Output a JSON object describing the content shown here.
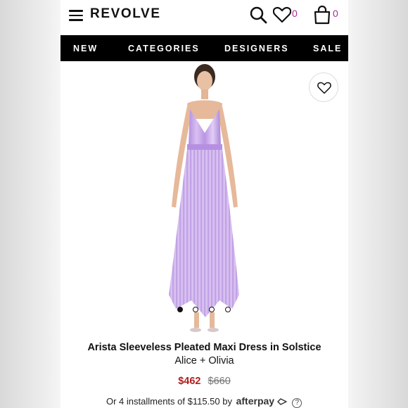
{
  "header": {
    "logo": "REVOLVE",
    "wishlist_count": "0",
    "bag_count": "0",
    "icons": [
      "menu-icon",
      "search-icon",
      "heart-icon",
      "bag-icon"
    ]
  },
  "nav": {
    "items": [
      "NEW",
      "CATEGORIES",
      "DESIGNERS",
      "SALE"
    ]
  },
  "gallery": {
    "image_count": 4,
    "active_index": 0
  },
  "product": {
    "title": "Arista Sleeveless Pleated Maxi Dress in Solstice",
    "brand": "Alice + Olivia",
    "sale_price": "$462",
    "original_price": "$660",
    "installments_text": "Or 4 installments of $115.50 by",
    "afterpay_label": "afterpay",
    "help_symbol": "?"
  },
  "colors": {
    "accent": "#b02a8b",
    "sale_price": "#b11e1e",
    "navbar": "#000000",
    "dress": "#c9a4e8"
  }
}
